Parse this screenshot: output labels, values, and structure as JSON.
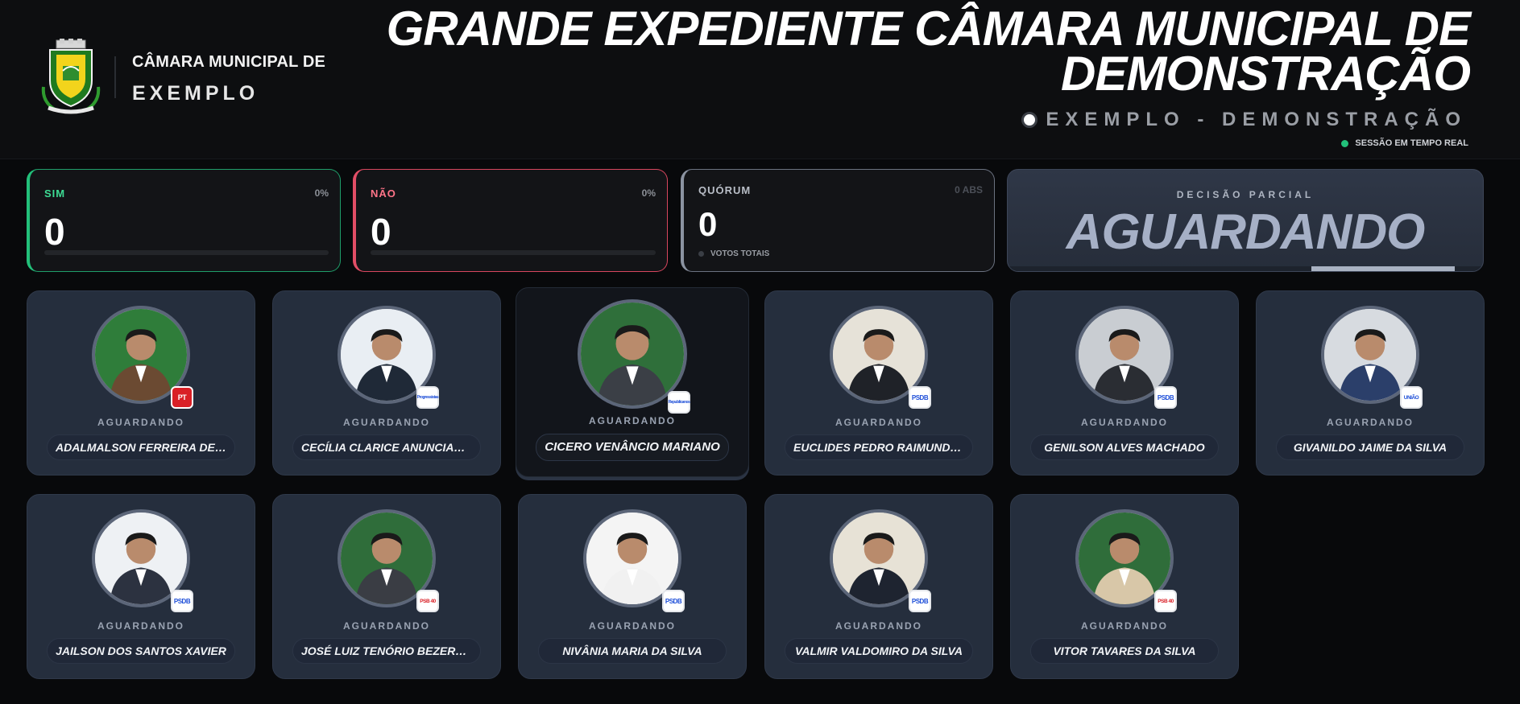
{
  "header": {
    "brand_line1": "CÂMARA MUNICIPAL DE",
    "brand_line2": "EXEMPLO",
    "title": "GRANDE EXPEDIENTE CÂMARA MUNICIPAL DE DEMONSTRAÇÃO",
    "subtitle": "EXEMPLO - DEMONSTRAÇÃO",
    "live_status": "SESSÃO EM TEMPO REAL"
  },
  "stats": {
    "sim": {
      "label": "SIM",
      "value": "0",
      "percent": "0%"
    },
    "nao": {
      "label": "NÃO",
      "value": "0",
      "percent": "0%"
    },
    "quorum": {
      "label": "QUÓRUM",
      "value": "0",
      "abs": "0 ABS",
      "votos_label": "VOTOS TOTAIS"
    },
    "decisao": {
      "label": "DECISÃO PARCIAL",
      "value": "AGUARDANDO"
    }
  },
  "colors": {
    "sim": "#22c07a",
    "nao": "#e24e66",
    "quorum": "#8b93a1",
    "live": "#22c07a",
    "card_bg": "#252e3d"
  },
  "councillors": [
    {
      "name": "ADALMALSON FERREIRA DE MA...",
      "status": "AGUARDANDO",
      "party": "PT"
    },
    {
      "name": "CECÍLIA CLARICE ANUNCIADA ...",
      "status": "AGUARDANDO",
      "party": "Progressistas"
    },
    {
      "name": "CICERO VENÂNCIO MARIANO",
      "status": "AGUARDANDO",
      "party": "Republicanos"
    },
    {
      "name": "EUCLIDES PEDRO RAIMUNDO N...",
      "status": "AGUARDANDO",
      "party": "PSDB"
    },
    {
      "name": "GENILSON ALVES MACHADO",
      "status": "AGUARDANDO",
      "party": "PSDB"
    },
    {
      "name": "GIVANILDO JAIME DA SILVA",
      "status": "AGUARDANDO",
      "party": "UNIÃO"
    },
    {
      "name": "JAILSON DOS SANTOS XAVIER",
      "status": "AGUARDANDO",
      "party": "PSDB"
    },
    {
      "name": "JOSÉ LUIZ TENÓRIO BEZERRA J...",
      "status": "AGUARDANDO",
      "party": "PSB 40"
    },
    {
      "name": "NIVÂNIA MARIA DA SILVA",
      "status": "AGUARDANDO",
      "party": "PSDB"
    },
    {
      "name": "VALMIR VALDOMIRO DA SILVA",
      "status": "AGUARDANDO",
      "party": "PSDB"
    },
    {
      "name": "VITOR TAVARES DA SILVA",
      "status": "AGUARDANDO",
      "party": "PSB 40"
    }
  ]
}
